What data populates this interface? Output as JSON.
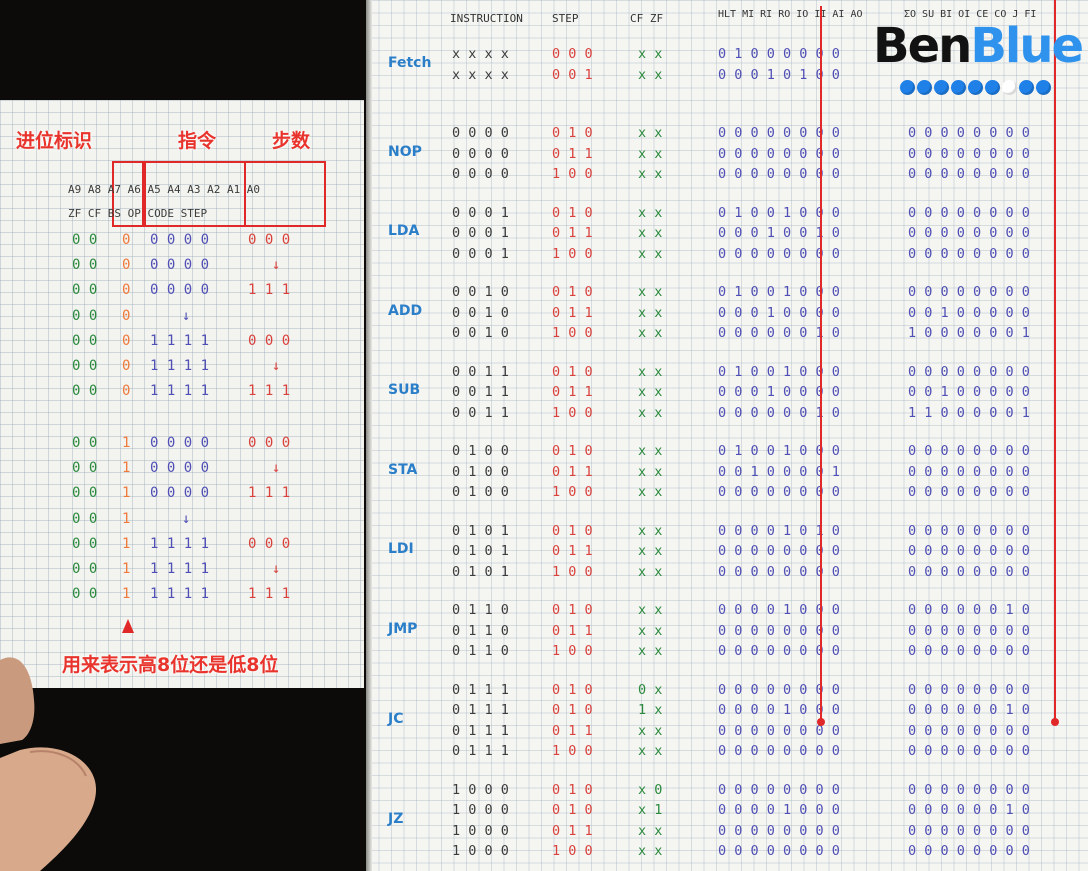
{
  "left_sheet": {
    "labels": {
      "carry_flag": "进位标识",
      "instruction": "指令",
      "step": "步数",
      "note": "用来表示高8位还是低8位"
    },
    "header_line1": "A9 A8 A7 A6 A5 A4 A3 A2 A1 A0",
    "header_line2": "ZF CF BS OP CODE STEP",
    "block1": [
      {
        "flags": "0 0",
        "bs": "0",
        "op": "0 0 0 0",
        "step": "0 0 0"
      },
      {
        "flags": "0 0",
        "bs": "0",
        "op": "0 0 0 0",
        "step": "↓"
      },
      {
        "flags": "0 0",
        "bs": "0",
        "op": "0 0 0 0",
        "step": "1 1 1"
      },
      {
        "flags": "0 0",
        "bs": "0",
        "op": "↓",
        "step": ""
      },
      {
        "flags": "0 0",
        "bs": "0",
        "op": "1 1 1 1",
        "step": "0 0 0"
      },
      {
        "flags": "0 0",
        "bs": "0",
        "op": "1 1 1 1",
        "step": "↓"
      },
      {
        "flags": "0 0",
        "bs": "0",
        "op": "1 1 1 1",
        "step": "1 1 1"
      }
    ],
    "block2": [
      {
        "flags": "0 0",
        "bs": "1",
        "op": "0 0 0 0",
        "step": "0 0 0"
      },
      {
        "flags": "0 0",
        "bs": "1",
        "op": "0 0 0 0",
        "step": "↓"
      },
      {
        "flags": "0 0",
        "bs": "1",
        "op": "0 0 0 0",
        "step": "1 1 1"
      },
      {
        "flags": "0 0",
        "bs": "1",
        "op": "↓",
        "step": ""
      },
      {
        "flags": "0 0",
        "bs": "1",
        "op": "1 1 1 1",
        "step": "0 0 0"
      },
      {
        "flags": "0 0",
        "bs": "1",
        "op": "1 1 1 1",
        "step": "↓"
      },
      {
        "flags": "0 0",
        "bs": "1",
        "op": "1 1 1 1",
        "step": "1 1 1"
      }
    ]
  },
  "right_sheet": {
    "header": {
      "instruction": "INSTRUCTION",
      "step": "STEP",
      "flags": "CF ZF",
      "ctrl_hi": "HLT MI RI RO IO II AI AO",
      "ctrl_lo": "ΣO SU BI OI CE CO J FI"
    },
    "groups": [
      {
        "name": "Fetch",
        "rows": [
          {
            "instr": "x x x x",
            "step": "0 0 0",
            "flags": "x x",
            "hi": "0 1 0 0 0 0 0 0",
            "lo": ""
          },
          {
            "instr": "x x x x",
            "step": "0 0 1",
            "flags": "x x",
            "hi": "0 0 0 1 0 1 0 0",
            "lo": ""
          }
        ]
      },
      {
        "name": "NOP",
        "rows": [
          {
            "instr": "0 0 0 0",
            "step": "0 1 0",
            "flags": "x x",
            "hi": "0 0 0 0 0 0 0 0",
            "lo": "0 0 0 0 0 0 0 0"
          },
          {
            "instr": "0 0 0 0",
            "step": "0 1 1",
            "flags": "x x",
            "hi": "0 0 0 0 0 0 0 0",
            "lo": "0 0 0 0 0 0 0 0"
          },
          {
            "instr": "0 0 0 0",
            "step": "1 0 0",
            "flags": "x x",
            "hi": "0 0 0 0 0 0 0 0",
            "lo": "0 0 0 0 0 0 0 0"
          }
        ]
      },
      {
        "name": "LDA",
        "rows": [
          {
            "instr": "0 0 0 1",
            "step": "0 1 0",
            "flags": "x x",
            "hi": "0 1 0 0 1 0 0 0",
            "lo": "0 0 0 0 0 0 0 0"
          },
          {
            "instr": "0 0 0 1",
            "step": "0 1 1",
            "flags": "x x",
            "hi": "0 0 0 1 0 0 1 0",
            "lo": "0 0 0 0 0 0 0 0"
          },
          {
            "instr": "0 0 0 1",
            "step": "1 0 0",
            "flags": "x x",
            "hi": "0 0 0 0 0 0 0 0",
            "lo": "0 0 0 0 0 0 0 0"
          }
        ]
      },
      {
        "name": "ADD",
        "rows": [
          {
            "instr": "0 0 1 0",
            "step": "0 1 0",
            "flags": "x x",
            "hi": "0 1 0 0 1 0 0 0",
            "lo": "0 0 0 0 0 0 0 0"
          },
          {
            "instr": "0 0 1 0",
            "step": "0 1 1",
            "flags": "x x",
            "hi": "0 0 0 1 0 0 0 0",
            "lo": "0 0 1 0 0 0 0 0"
          },
          {
            "instr": "0 0 1 0",
            "step": "1 0 0",
            "flags": "x x",
            "hi": "0 0 0 0 0 0 1 0",
            "lo": "1 0 0 0 0 0 0 1"
          }
        ]
      },
      {
        "name": "SUB",
        "rows": [
          {
            "instr": "0 0 1 1",
            "step": "0 1 0",
            "flags": "x x",
            "hi": "0 1 0 0 1 0 0 0",
            "lo": "0 0 0 0 0 0 0 0"
          },
          {
            "instr": "0 0 1 1",
            "step": "0 1 1",
            "flags": "x x",
            "hi": "0 0 0 1 0 0 0 0",
            "lo": "0 0 1 0 0 0 0 0"
          },
          {
            "instr": "0 0 1 1",
            "step": "1 0 0",
            "flags": "x x",
            "hi": "0 0 0 0 0 0 1 0",
            "lo": "1 1 0 0 0 0 0 1"
          }
        ]
      },
      {
        "name": "STA",
        "rows": [
          {
            "instr": "0 1 0 0",
            "step": "0 1 0",
            "flags": "x x",
            "hi": "0 1 0 0 1 0 0 0",
            "lo": "0 0 0 0 0 0 0 0"
          },
          {
            "instr": "0 1 0 0",
            "step": "0 1 1",
            "flags": "x x",
            "hi": "0 0 1 0 0 0 0 1",
            "lo": "0 0 0 0 0 0 0 0"
          },
          {
            "instr": "0 1 0 0",
            "step": "1 0 0",
            "flags": "x x",
            "hi": "0 0 0 0 0 0 0 0",
            "lo": "0 0 0 0 0 0 0 0"
          }
        ]
      },
      {
        "name": "LDI",
        "rows": [
          {
            "instr": "0 1 0 1",
            "step": "0 1 0",
            "flags": "x x",
            "hi": "0 0 0 0 1 0 1 0",
            "lo": "0 0 0 0 0 0 0 0"
          },
          {
            "instr": "0 1 0 1",
            "step": "0 1 1",
            "flags": "x x",
            "hi": "0 0 0 0 0 0 0 0",
            "lo": "0 0 0 0 0 0 0 0"
          },
          {
            "instr": "0 1 0 1",
            "step": "1 0 0",
            "flags": "x x",
            "hi": "0 0 0 0 0 0 0 0",
            "lo": "0 0 0 0 0 0 0 0"
          }
        ]
      },
      {
        "name": "JMP",
        "rows": [
          {
            "instr": "0 1 1 0",
            "step": "0 1 0",
            "flags": "x x",
            "hi": "0 0 0 0 1 0 0 0",
            "lo": "0 0 0 0 0 0 1 0"
          },
          {
            "instr": "0 1 1 0",
            "step": "0 1 1",
            "flags": "x x",
            "hi": "0 0 0 0 0 0 0 0",
            "lo": "0 0 0 0 0 0 0 0"
          },
          {
            "instr": "0 1 1 0",
            "step": "1 0 0",
            "flags": "x x",
            "hi": "0 0 0 0 0 0 0 0",
            "lo": "0 0 0 0 0 0 0 0"
          }
        ]
      },
      {
        "name": "JC",
        "rows": [
          {
            "instr": "0 1 1 1",
            "step": "0 1 0",
            "flags": "0 x",
            "hi": "0 0 0 0 0 0 0 0",
            "lo": "0 0 0 0 0 0 0 0"
          },
          {
            "instr": "0 1 1 1",
            "step": "0 1 0",
            "flags": "1 x",
            "hi": "0 0 0 0 1 0 0 0",
            "lo": "0 0 0 0 0 0 1 0"
          },
          {
            "instr": "0 1 1 1",
            "step": "0 1 1",
            "flags": "x x",
            "hi": "0 0 0 0 0 0 0 0",
            "lo": "0 0 0 0 0 0 0 0"
          },
          {
            "instr": "0 1 1 1",
            "step": "1 0 0",
            "flags": "x x",
            "hi": "0 0 0 0 0 0 0 0",
            "lo": "0 0 0 0 0 0 0 0"
          }
        ]
      },
      {
        "name": "JZ",
        "rows": [
          {
            "instr": "1 0 0 0",
            "step": "0 1 0",
            "flags": "x 0",
            "hi": "0 0 0 0 0 0 0 0",
            "lo": "0 0 0 0 0 0 0 0"
          },
          {
            "instr": "1 0 0 0",
            "step": "0 1 0",
            "flags": "x 1",
            "hi": "0 0 0 0 1 0 0 0",
            "lo": "0 0 0 0 0 0 1 0"
          },
          {
            "instr": "1 0 0 0",
            "step": "0 1 1",
            "flags": "x x",
            "hi": "0 0 0 0 0 0 0 0",
            "lo": "0 0 0 0 0 0 0 0"
          },
          {
            "instr": "1 0 0 0",
            "step": "1 0 0",
            "flags": "x x",
            "hi": "0 0 0 0 0 0 0 0",
            "lo": "0 0 0 0 0 0 0 0"
          }
        ]
      }
    ]
  },
  "logo": {
    "ben": "Ben",
    "blue": "Blue"
  },
  "colors": {
    "annotation_red": "#e02828",
    "ink_blue": "#2b7fc9",
    "ink_red": "#ee7a3c",
    "ink_green": "#2b8a3e",
    "ink_purple": "#4f4fb5"
  }
}
